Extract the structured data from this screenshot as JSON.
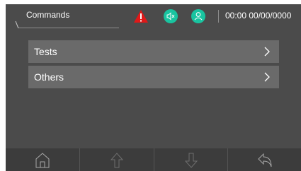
{
  "header": {
    "title": "Commands",
    "datetime": "00:00  00/00/0000",
    "icons": {
      "alert": "warning-icon",
      "mute": "mute-icon",
      "user": "user-icon"
    },
    "colors": {
      "alert": "#e01818",
      "status": "#19c4a0"
    }
  },
  "menu": {
    "items": [
      {
        "label": "Tests",
        "icon": "chevron-right-icon"
      },
      {
        "label": "Others",
        "icon": "chevron-right-icon"
      }
    ]
  },
  "footer": {
    "buttons": [
      {
        "icon": "home-icon"
      },
      {
        "icon": "arrow-up-icon"
      },
      {
        "icon": "arrow-down-icon"
      },
      {
        "icon": "back-icon"
      }
    ]
  }
}
